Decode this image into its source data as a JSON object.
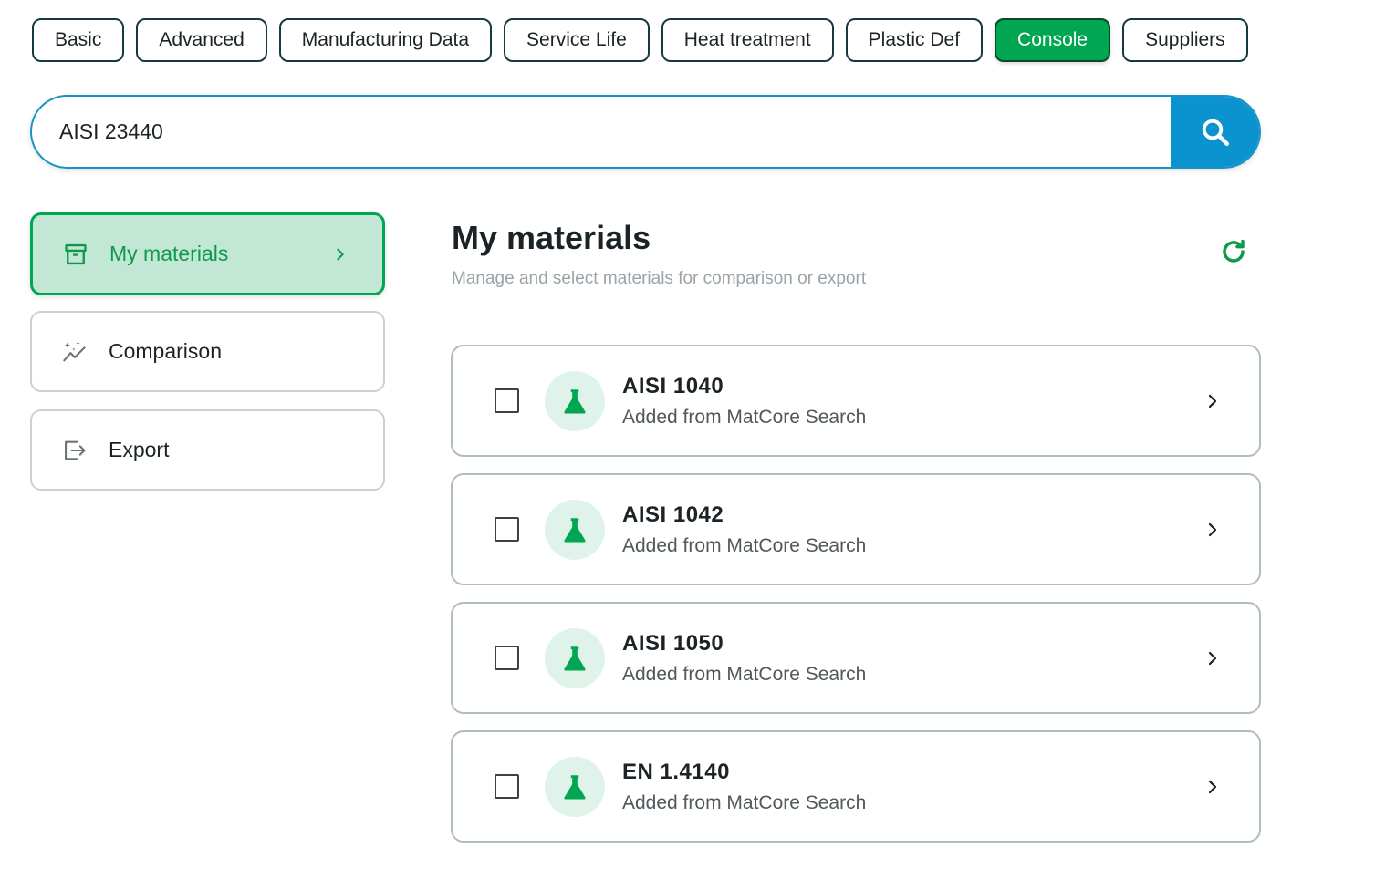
{
  "tabs": [
    {
      "label": "Basic"
    },
    {
      "label": "Advanced"
    },
    {
      "label": "Manufacturing Data"
    },
    {
      "label": "Service Life"
    },
    {
      "label": "Heat treatment"
    },
    {
      "label": "Plastic Def"
    },
    {
      "label": "Console",
      "active": true
    },
    {
      "label": "Suppliers"
    }
  ],
  "search": {
    "value": "AISI 23440",
    "icon": "search-icon"
  },
  "sidebar": {
    "items": [
      {
        "label": "My materials",
        "icon": "archive-icon",
        "active": true
      },
      {
        "label": "Comparison",
        "icon": "sparkle-chart-icon"
      },
      {
        "label": "Export",
        "icon": "export-icon"
      }
    ]
  },
  "main": {
    "title": "My materials",
    "subtitle": "Manage and select materials for comparison or export",
    "refresh_icon": "refresh-icon"
  },
  "materials": [
    {
      "name": "AISI 1040",
      "source": "Added from MatCore Search",
      "checked": false
    },
    {
      "name": "AISI 1042",
      "source": "Added from MatCore Search",
      "checked": false
    },
    {
      "name": "AISI 1050",
      "source": "Added from MatCore Search",
      "checked": false
    },
    {
      "name": "EN 1.4140",
      "source": "Added from MatCore Search",
      "checked": false
    }
  ],
  "colors": {
    "accent_green": "#00a651",
    "search_blue": "#0a93cf",
    "active_bg": "#c2e7d4"
  }
}
